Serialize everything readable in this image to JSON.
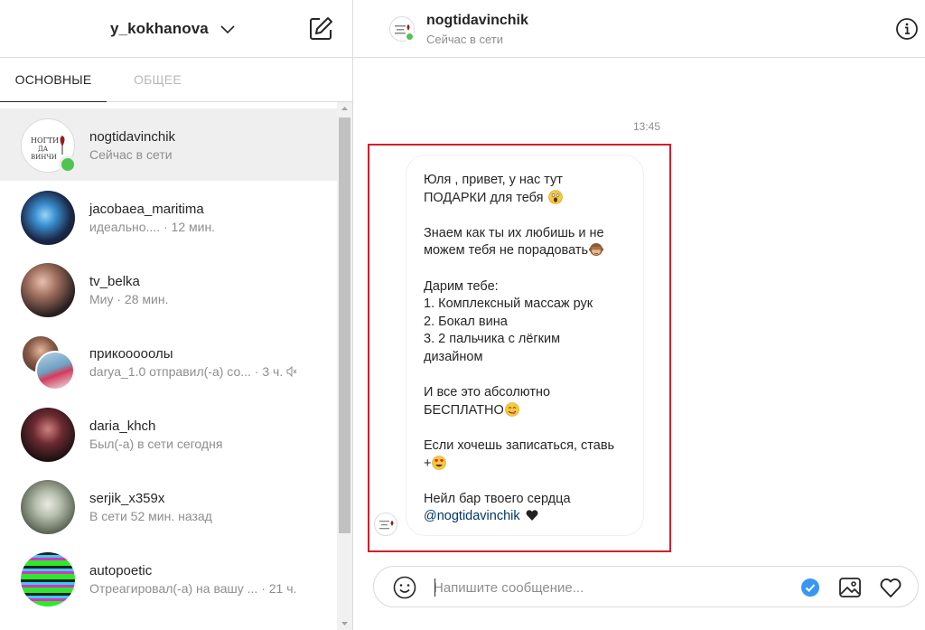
{
  "sidebar": {
    "account_name": "y_kokhanova",
    "tabs": [
      {
        "label": "ОСНОВНЫЕ"
      },
      {
        "label": "ОБЩЕЕ"
      }
    ],
    "threads": [
      {
        "username": "nogtidavinchik",
        "subtitle": "Сейчас в сети"
      },
      {
        "username": "jacobaea_maritima",
        "subtitle": "идеально.... · 12 мин."
      },
      {
        "username": "tv_belka",
        "subtitle": "Миу · 28 мин."
      },
      {
        "username": "прикооооолы",
        "subtitle": "darya_1.0 отправил(-а) со... · 3 ч."
      },
      {
        "username": "daria_khch",
        "subtitle": "Был(-а) в сети сегодня"
      },
      {
        "username": "serjik_x359x",
        "subtitle": "В сети 52 мин. назад"
      },
      {
        "username": "autopoetic",
        "subtitle": "Отреагировал(-а) на вашу ... · 21 ч."
      }
    ]
  },
  "chat": {
    "username": "nogtidavinchik",
    "status": "Сейчас в сети",
    "timestamp": "13:45",
    "message_lines": [
      "Юля , привет, у нас тут",
      "ПОДАРКИ для тебя",
      "",
      "Знаем как ты их любишь и не",
      "можем тебя не порадовать",
      "",
      "Дарим тебе:",
      "1. Комплексный массаж рук",
      "2. Бокал вина",
      "3. 2 пальчика с лёгким",
      "дизайном",
      "",
      "И все это абсолютно",
      "БЕСПЛАТНО",
      "",
      "Если хочешь записаться, ставь",
      "+",
      "",
      "Нейл бар твоего сердца",
      "@nogtidavinchik"
    ],
    "composer_placeholder": "Напишите сообщение..."
  },
  "colors": {
    "online": "#4ec54e",
    "highlight_border": "#d0202b",
    "mention": "#00376b",
    "verified_blue": "#3897f0"
  }
}
